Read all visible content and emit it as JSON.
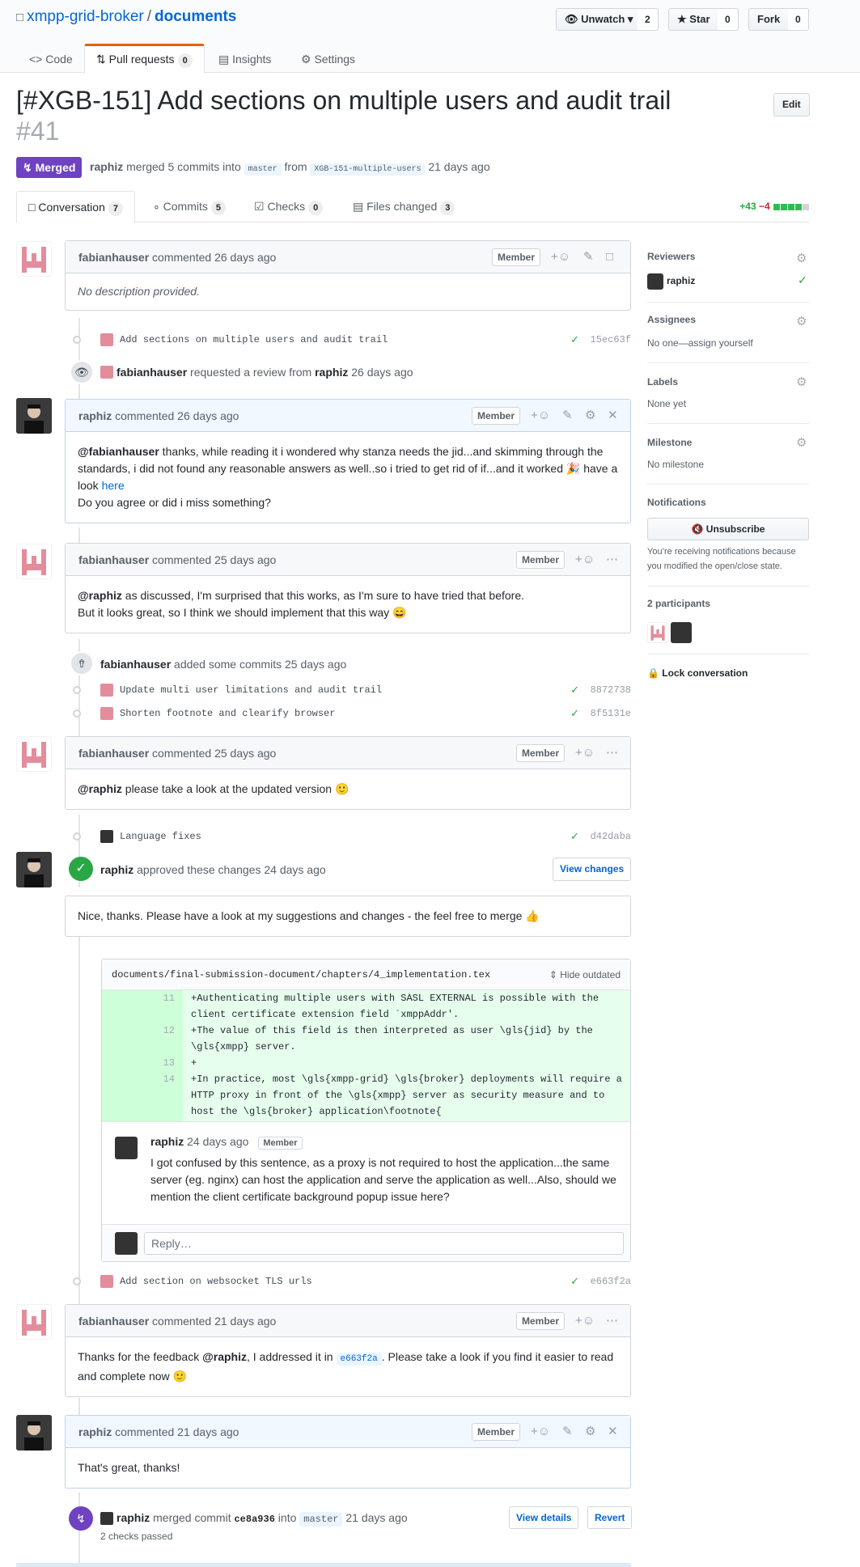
{
  "repo": {
    "owner": "xmpp-grid-broker",
    "name": "documents"
  },
  "header_buttons": {
    "watch": "Unwatch",
    "watch_count": "2",
    "star": "Star",
    "star_count": "0",
    "fork": "Fork",
    "fork_count": "0"
  },
  "repo_tabs": [
    {
      "label": "Code",
      "counter": ""
    },
    {
      "label": "Pull requests",
      "counter": "0"
    },
    {
      "label": "Insights",
      "counter": ""
    },
    {
      "label": "Settings",
      "counter": ""
    }
  ],
  "pr": {
    "title": "[#XGB-151] Add sections on multiple users and audit trail",
    "number": "#41",
    "edit_label": "Edit",
    "state": "Merged",
    "author": "raphiz",
    "meta_merged": "merged 5 commits into",
    "base": "master",
    "from": "from",
    "head": "XGB-151-multiple-users",
    "time": "21 days ago"
  },
  "pr_tabs": [
    {
      "label": "Conversation",
      "counter": "7"
    },
    {
      "label": "Commits",
      "counter": "5"
    },
    {
      "label": "Checks",
      "counter": "0"
    },
    {
      "label": "Files changed",
      "counter": "3"
    }
  ],
  "diffstat": {
    "add": "+43",
    "del": "−4"
  },
  "member_label": "Member",
  "timeline": {
    "c1": {
      "author": "fabianhauser",
      "verb": "commented 26 days ago",
      "body": "No description provided."
    },
    "commit1": {
      "msg": "Add sections on multiple users and audit trail",
      "sha": "15ec63f"
    },
    "review_req": {
      "actor": "fabianhauser",
      "text": "requested a review from",
      "target": "raphiz",
      "time": "26 days ago"
    },
    "c2": {
      "author": "raphiz",
      "verb": "commented 26 days ago",
      "mention": "@fabianhauser",
      "body1": " thanks, while reading it i wondered why stanza needs the jid...and skimming through the standards, i did not found any reasonable answers as well..so i tried to get rid of if...and it worked 🎉 have a look ",
      "link": "here",
      "body2": "Do you agree or did i miss something?"
    },
    "c3": {
      "author": "fabianhauser",
      "verb": "commented 25 days ago",
      "mention": "@raphiz",
      "body1": " as discussed, I'm surprised that this works, as I'm sure to have tried that before.",
      "body2": "But it looks great, so I think we should implement that this way 😄"
    },
    "added_commits": {
      "actor": "fabianhauser",
      "text": "added some commits",
      "time": "25 days ago"
    },
    "commit2": {
      "msg": "Update multi user limitations and audit trail",
      "sha": "8872738"
    },
    "commit3": {
      "msg": "Shorten footnote and clearify browser",
      "sha": "8f5131e"
    },
    "c4": {
      "author": "fabianhauser",
      "verb": "commented 25 days ago",
      "mention": "@raphiz",
      "body": " please take a look at the updated version 🙂"
    },
    "commit4": {
      "msg": "Language fixes",
      "sha": "d42daba"
    },
    "review": {
      "author": "raphiz",
      "text": "approved these changes",
      "time": "24 days ago",
      "view_changes": "View changes",
      "body": "Nice, thanks. Please have a look at my suggestions and changes - the feel free to merge 👍"
    },
    "diff": {
      "file": "documents/final-submission-document/chapters/4_implementation.tex",
      "hide_outdated": "Hide outdated",
      "lines": [
        {
          "n": "11",
          "text": "+Authenticating multiple users with SASL EXTERNAL is possible with the client certificate extension field `xmppAddr'."
        },
        {
          "n": "12",
          "text": "+The value of this field is then interpreted as user \\gls{jid} by the \\gls{xmpp} server."
        },
        {
          "n": "13",
          "text": "+"
        },
        {
          "n": "14",
          "text": "+In practice, most \\gls{xmpp-grid} \\gls{broker} deployments will require a HTTP proxy in front of the \\gls{xmpp} server as security measure and to host the \\gls{broker} application\\footnote{"
        }
      ],
      "comment_author": "raphiz",
      "comment_time": "24 days ago",
      "comment_body": "I got confused by this sentence, as a proxy is not required to host the application...the same server (eg. nginx) can host the application and serve the application as well...Also, should we mention the client certificate background popup issue here?",
      "reply_placeholder": "Reply…"
    },
    "commit5": {
      "msg": "Add section on websocket TLS urls",
      "sha": "e663f2a"
    },
    "c5": {
      "author": "fabianhauser",
      "verb": "commented 21 days ago",
      "body1": "Thanks for the feedback ",
      "mention": "@raphiz",
      "body2": ", I addressed it in ",
      "sha": "e663f2a",
      "body3": ". Please take a look if you find it easier to read and complete now 🙂"
    },
    "c6": {
      "author": "raphiz",
      "verb": "commented 21 days ago",
      "body": "That's great, thanks!"
    },
    "merge": {
      "actor": "raphiz",
      "text": "merged commit",
      "sha": "ce8a936",
      "into": "into",
      "base": "master",
      "time": "21 days ago",
      "checks": "2 checks passed",
      "view_details": "View details",
      "revert": "Revert"
    }
  },
  "sidebar": {
    "reviewers": "Reviewers",
    "reviewer": "raphiz",
    "assignees": "Assignees",
    "assignees_value": "No one—assign yourself",
    "labels": "Labels",
    "labels_value": "None yet",
    "milestone": "Milestone",
    "milestone_value": "No milestone",
    "notifications": "Notifications",
    "unsubscribe": "Unsubscribe",
    "notif_reason": "You’re receiving notifications because you modified the open/close state.",
    "participants": "2 participants",
    "lock": "Lock conversation"
  },
  "colors": {
    "merged": "#6f42c1",
    "link": "#0366d6",
    "green": "#28a745",
    "red": "#cb2431"
  }
}
